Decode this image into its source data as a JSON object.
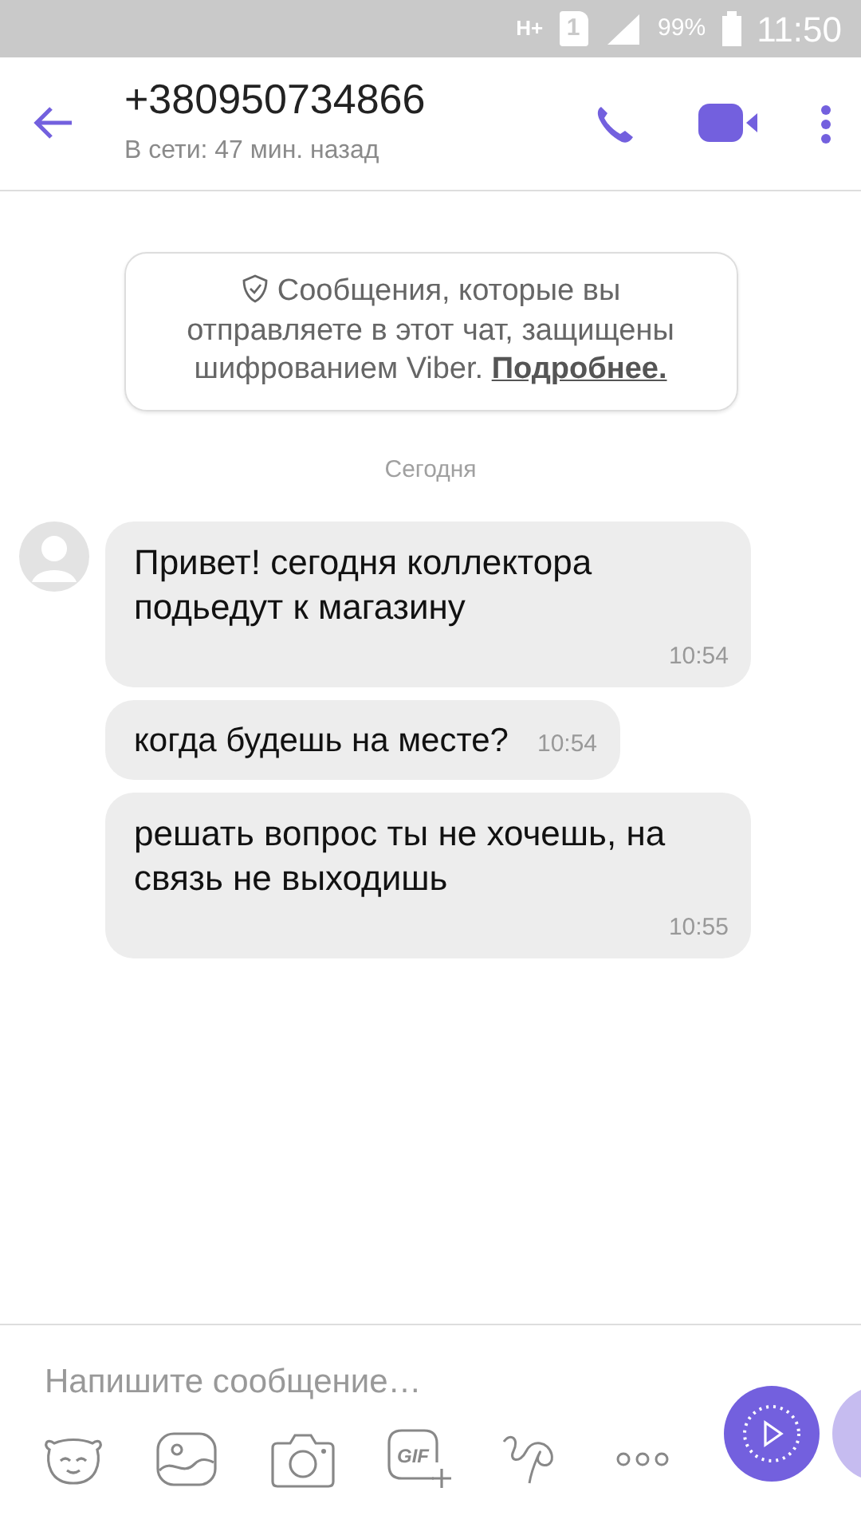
{
  "status_bar": {
    "network": "H+",
    "sim": "1",
    "battery": "99%",
    "time": "11:50"
  },
  "header": {
    "title": "+380950734866",
    "subtitle": "В сети: 47 мин. назад"
  },
  "notice": {
    "text": "Сообщения, которые вы отправляете в этот чат, защищены шифрованием Viber.",
    "link": "Подробнее."
  },
  "date_divider": "Сегодня",
  "messages": [
    {
      "text": "Привет! сегодня коллектора подьедут к магазину",
      "time": "10:54",
      "avatar": true
    },
    {
      "text": "когда будешь на месте?",
      "time": "10:54",
      "avatar": false
    },
    {
      "text": "решать вопрос ты не хочешь, на связь не выходишь",
      "time": "10:55",
      "avatar": false
    }
  ],
  "composer": {
    "placeholder": "Напишите сообщение…",
    "gif_label": "GIF"
  }
}
